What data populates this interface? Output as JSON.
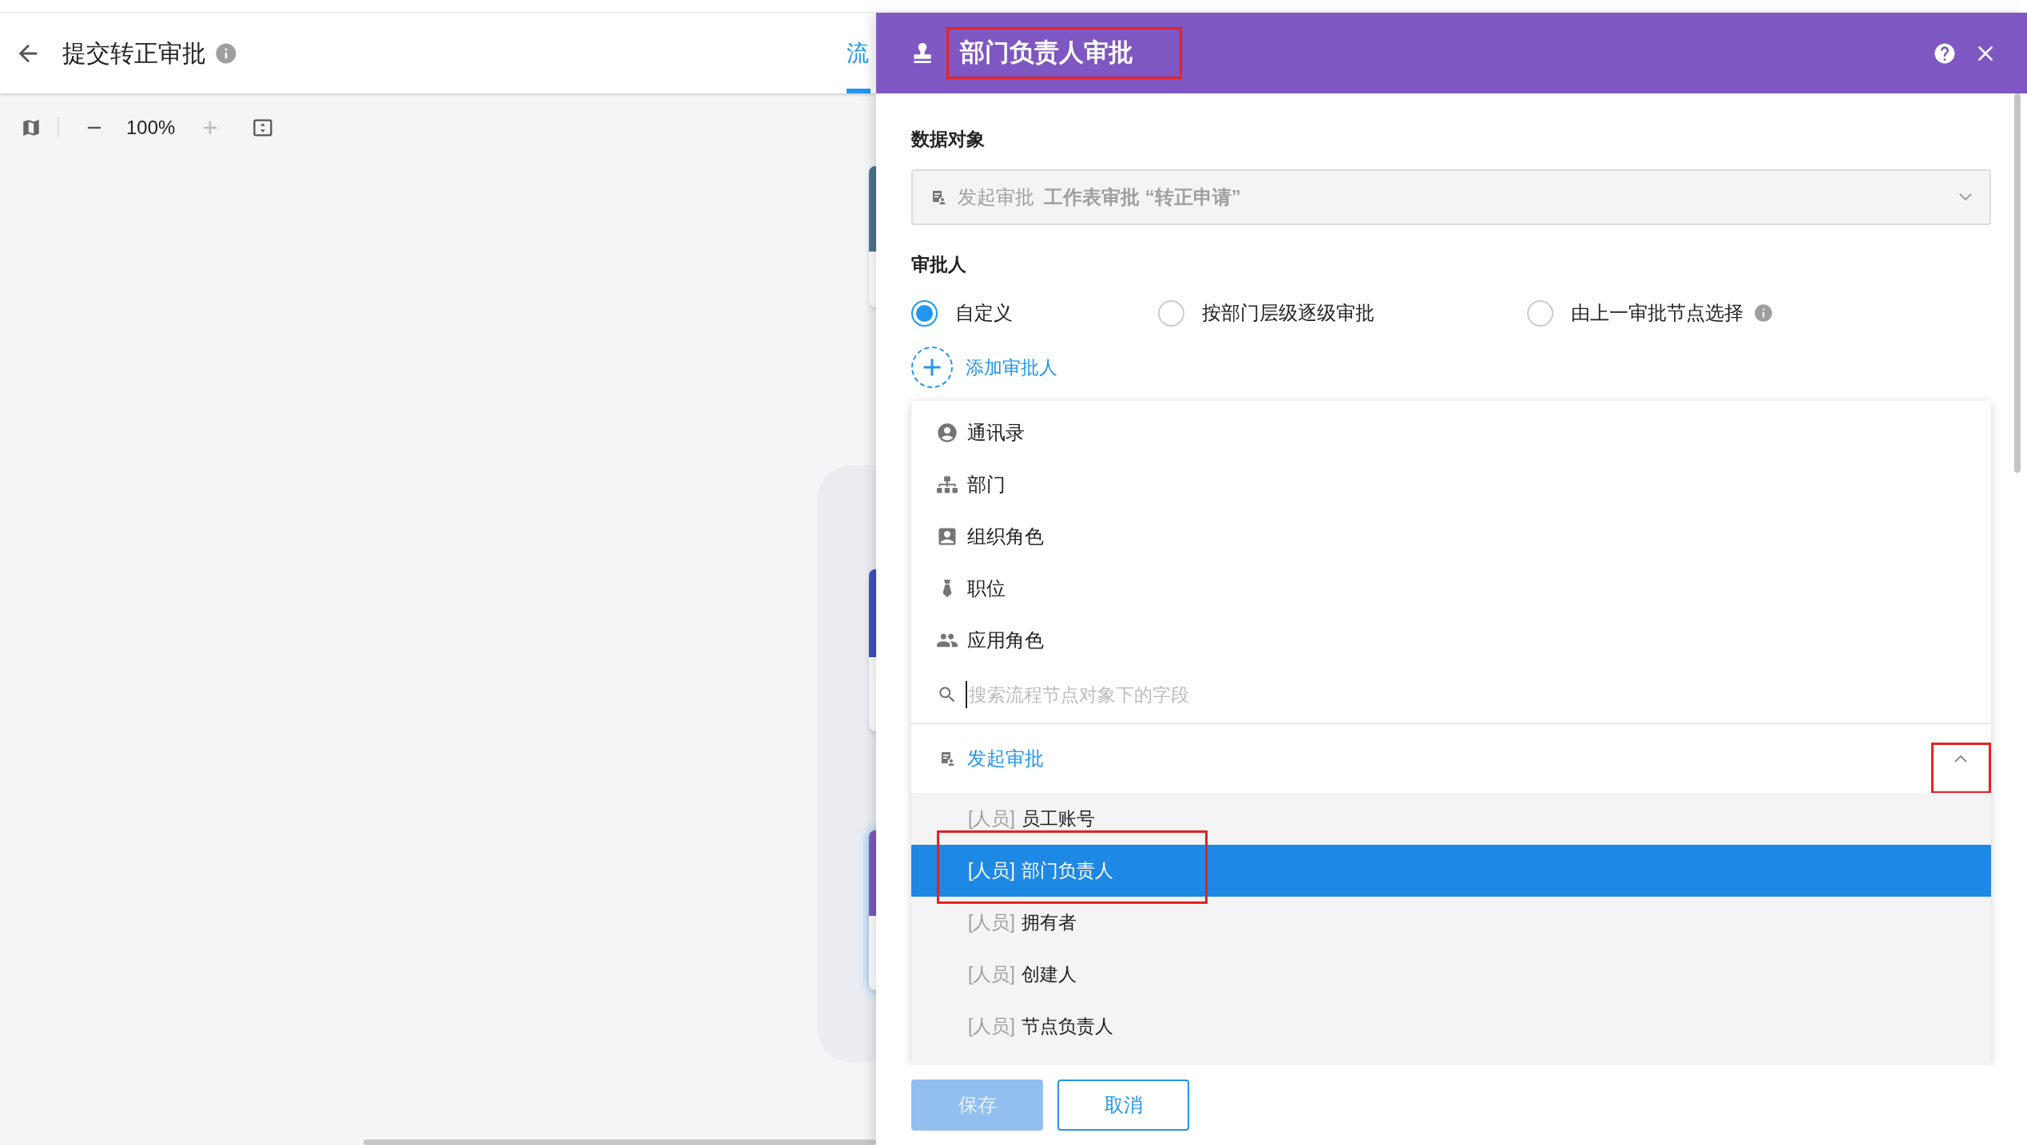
{
  "page": {
    "title": "提交转正审批",
    "tab_label": "流",
    "zoom": "100%"
  },
  "panel": {
    "title": "部门负责人审批",
    "title_marked": true,
    "data_object": {
      "label": "数据对象",
      "prefix": "发起审批",
      "value": "工作表审批 “转正申请”"
    },
    "approver": {
      "label": "审批人",
      "add_label": "添加审批人",
      "options": [
        {
          "label": "自定义",
          "selected": true,
          "info": false
        },
        {
          "label": "按部门层级逐级审批",
          "selected": false,
          "info": false
        },
        {
          "label": "由上一审批节点选择",
          "selected": false,
          "info": true
        }
      ]
    }
  },
  "dropdown": {
    "sources": [
      {
        "label": "通讯录",
        "kind": "contacts"
      },
      {
        "label": "部门",
        "kind": "department"
      },
      {
        "label": "组织角色",
        "kind": "org_role"
      },
      {
        "label": "职位",
        "kind": "position"
      },
      {
        "label": "应用角色",
        "kind": "app_role"
      }
    ],
    "search": {
      "placeholder": "搜索流程节点对象下的字段"
    },
    "group": {
      "label": "发起审批",
      "expanded": true,
      "toggle_marked": true,
      "fields": [
        {
          "tag": "[人员]",
          "label": "员工账号",
          "selected": false,
          "marked": false
        },
        {
          "tag": "[人员]",
          "label": "部门负责人",
          "selected": true,
          "marked": true
        },
        {
          "tag": "[人员]",
          "label": "拥有者",
          "selected": false,
          "marked": false
        },
        {
          "tag": "[人员]",
          "label": "创建人",
          "selected": false,
          "marked": false
        },
        {
          "tag": "[人员]",
          "label": "节点负责人",
          "selected": false,
          "marked": false
        }
      ]
    }
  },
  "buttons": [
    {
      "label": "保存",
      "kind": "primary",
      "disabled": true
    },
    {
      "label": "取消",
      "kind": "secondary",
      "disabled": false
    }
  ]
}
